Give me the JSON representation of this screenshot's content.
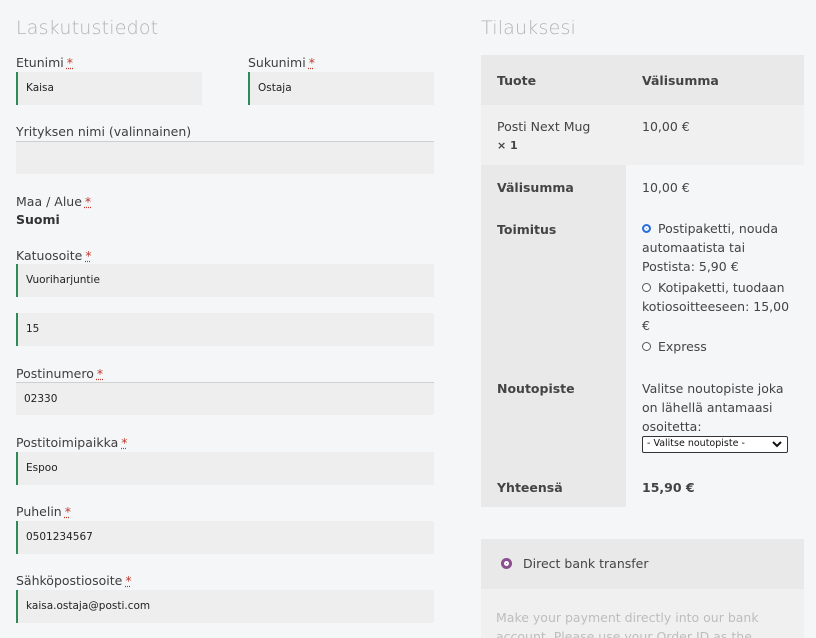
{
  "billing": {
    "heading": "Laskutustiedot",
    "required_mark": "*",
    "first_name": {
      "label": "Etunimi",
      "value": "Kaisa"
    },
    "last_name": {
      "label": "Sukunimi",
      "value": "Ostaja"
    },
    "company": {
      "label": "Yrityksen nimi (valinnainen)",
      "value": ""
    },
    "country": {
      "label": "Maa / Alue",
      "value": "Suomi"
    },
    "street": {
      "label": "Katuosoite",
      "value": "Vuoriharjuntie",
      "line2": "15"
    },
    "postcode": {
      "label": "Postinumero",
      "value": "02330"
    },
    "city": {
      "label": "Postitoimipaikka",
      "value": "Espoo"
    },
    "phone": {
      "label": "Puhelin",
      "value": "0501234567"
    },
    "email": {
      "label": "Sähköpostiosoite",
      "value": "kaisa.ostaja@posti.com"
    }
  },
  "order": {
    "heading": "Tilauksesi",
    "col_product": "Tuote",
    "col_subtotal": "Välisumma",
    "product_name": "Posti Next Mug",
    "product_qty": "× 1",
    "product_price": "10,00 €",
    "subtotal_label": "Välisumma",
    "subtotal_value": "10,00 €",
    "shipping_label": "Toimitus",
    "shipping_options": [
      {
        "label": "Postipaketti, nouda automaatista tai Postista: 5,90 €",
        "selected": true
      },
      {
        "label": "Kotipaketti, tuodaan kotiosoitteeseen: 15,00 €",
        "selected": false
      },
      {
        "label": "Express",
        "selected": false
      }
    ],
    "pickup_label": "Noutopiste",
    "pickup_text": "Valitse noutopiste joka on lähellä antamaasi osoitetta:",
    "pickup_select": "- Valitse noutopiste -",
    "total_label": "Yhteensä",
    "total_value": "15,90 €"
  },
  "payment": {
    "method_label": "Direct bank transfer",
    "description": "Make your payment directly into our bank account. Please use your Order ID as the payment"
  },
  "colors": {
    "accent_border": "#2e8b57",
    "radio_selected": "#2a6fdb",
    "payment_radio": "#8b4f8e"
  }
}
